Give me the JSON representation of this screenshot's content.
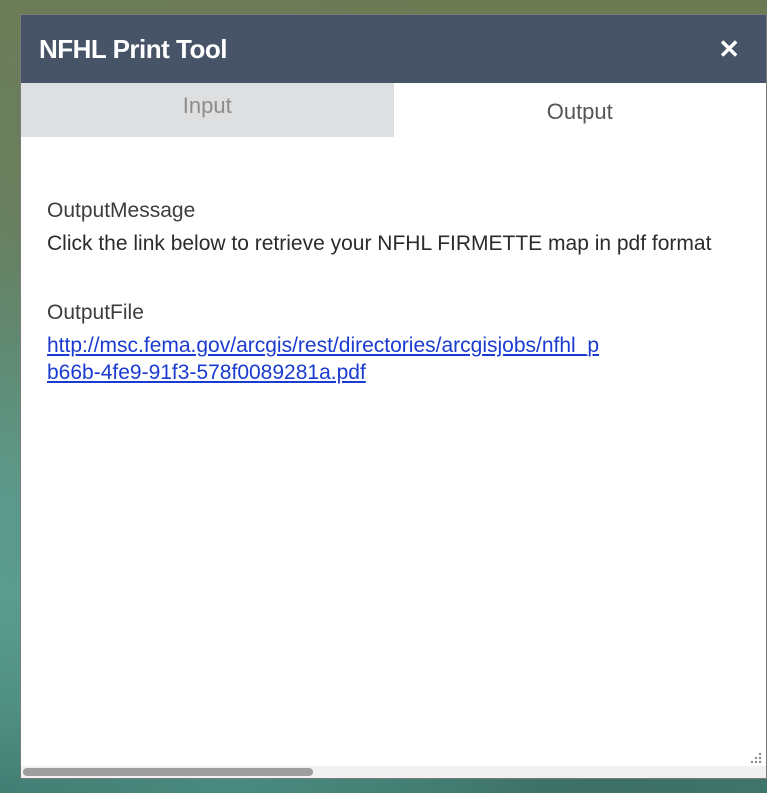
{
  "panel": {
    "title": "NFHL Print Tool",
    "close_glyph": "✕",
    "close_icon": "close-icon"
  },
  "tabs": [
    {
      "label": "Input",
      "active": false
    },
    {
      "label": "Output",
      "active": true
    }
  ],
  "output": {
    "message_label": "OutputMessage",
    "message_text": "Click the link below to retrieve your NFHL FIRMETTE map in pdf format",
    "file_label": "OutputFile",
    "file_link_line1": "http://msc.fema.gov/arcgis/rest/directories/arcgisjobs/nfhl_p",
    "file_link_line2": "b66b-4fe9-91f3-578f0089281a.pdf"
  },
  "colors": {
    "title_bar": "#475366",
    "link": "#1a3bd1",
    "inactive_tab": "#dedfe0"
  },
  "icons": {
    "resize": "resize-grip-icon"
  }
}
